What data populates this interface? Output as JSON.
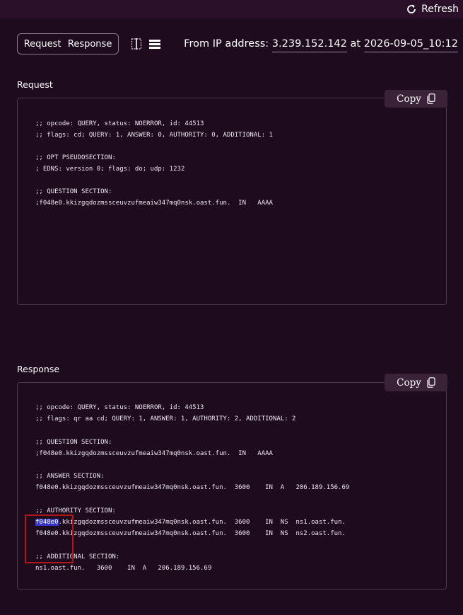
{
  "topbar": {
    "refresh_label": "Refresh"
  },
  "toggle": {
    "request_label": "Request",
    "response_label": "Response"
  },
  "ipinfo": {
    "prefix": "From IP address:",
    "ip": "3.239.152.142",
    "at": "at",
    "timestamp": "2026-09-05_10:12"
  },
  "request": {
    "label": "Request",
    "copy_label": "Copy",
    "lines": [
      ";; opcode: QUERY, status: NOERROR, id: 44513",
      ";; flags: cd; QUERY: 1, ANSWER: 0, AUTHORITY: 0, ADDITIONAL: 1",
      "",
      ";; OPT PSEUDOSECTION:",
      "; EDNS: version 0; flags: do; udp: 1232",
      "",
      ";; QUESTION SECTION:",
      ";f048e0.kkizgqdozmssceuvzufmeaiw347mq0nsk.oast.fun.  IN   AAAA"
    ]
  },
  "response": {
    "label": "Response",
    "copy_label": "Copy",
    "lines_top": [
      ";; opcode: QUERY, status: NOERROR, id: 44513",
      ";; flags: qr aa cd; QUERY: 1, ANSWER: 1, AUTHORITY: 2, ADDITIONAL: 2",
      "",
      ";; QUESTION SECTION:",
      ";f048e0.kkizgqdozmssceuvzufmeaiw347mq0nsk.oast.fun.  IN   AAAA",
      "",
      ";; ANSWER SECTION:",
      "f048e0.kkizgqdozmssceuvzufmeaiw347mq0nsk.oast.fun.  3600    IN  A   206.189.156.69",
      "",
      ";; AUTHORITY SECTION:"
    ],
    "highlight_word": "f048e0",
    "highlight_rest": ".kkizgqdozmssceuvzufmeaiw347mq0nsk.oast.fun.  3600    IN  NS  ns1.oast.fun.",
    "lines_bottom": [
      "f048e0.kkizgqdozmssceuvzufmeaiw347mq0nsk.oast.fun.  3600    IN  NS  ns2.oast.fun.",
      "",
      ";; ADDITIONAL SECTION:",
      "ns1.oast.fun.   3600    IN  A   206.189.156.69"
    ]
  }
}
